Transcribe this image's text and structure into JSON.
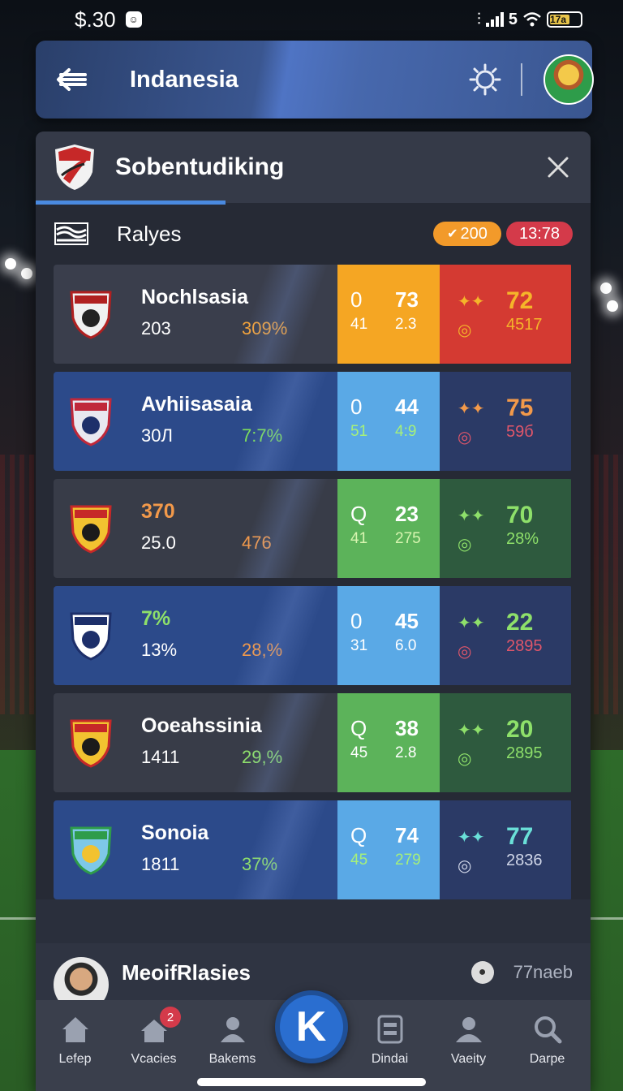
{
  "status": {
    "time": "$.30",
    "network": "5",
    "battery": "17a"
  },
  "app_bar": {
    "title": "Indanesia"
  },
  "panel": {
    "title": "Sobentudiking"
  },
  "section": {
    "title": "Ralyes",
    "pill_points": "200",
    "pill_time": "13:78"
  },
  "rows": [
    {
      "name": "Nochlsasia",
      "sub": "203",
      "pct": "309%",
      "pct_color": "#f2a23a",
      "m1": "0",
      "m2": "73",
      "m3": "41",
      "m4": "2.3",
      "r_top": "72",
      "r_bottom": "4517",
      "r_top_color": "#f5b52a",
      "r_bottom_color": "#f5b52a",
      "left_bg": "#3a3e4c",
      "mid_bg": "#f5a623",
      "right_bg": "#d43a32",
      "m_small_color": "#ffffff"
    },
    {
      "name": "Avhiisasaia",
      "sub": "30Л",
      "pct": "7:7%",
      "pct_color": "#7ee05a",
      "m1": "0",
      "m2": "44",
      "m3": "51",
      "m4": "4:9",
      "r_top": "75",
      "r_bottom": "59б",
      "r_top_color": "#f2994a",
      "r_bottom_color": "#e0566a",
      "left_bg": "#2c4a8a",
      "mid_bg": "#5aa9e6",
      "right_bg": "#2b3a66",
      "m_small_color": "#a6f07a"
    },
    {
      "name": "370",
      "sub": "25.0",
      "pct": "476",
      "pct_color": "#f2994a",
      "m1": "Q",
      "m2": "23",
      "m3": "41",
      "m4": "275",
      "r_top": "70",
      "r_bottom": "28%",
      "r_top_color": "#8ee06a",
      "r_bottom_color": "#8ee06a",
      "left_bg": "#383c48",
      "mid_bg": "#5cb35a",
      "right_bg": "#2e5a3e",
      "m_small_color": "#d8f5b0",
      "name_color": "#f2994a"
    },
    {
      "name": "7%",
      "sub": "13%",
      "pct": "28,%",
      "pct_color": "#f2994a",
      "m1": "0",
      "m2": "45",
      "m3": "31",
      "m4": "6.0",
      "r_top": "22",
      "r_bottom": "2895",
      "r_top_color": "#8ee06a",
      "r_bottom_color": "#e0566a",
      "left_bg": "#2c4a8a",
      "mid_bg": "#5aa9e6",
      "right_bg": "#2b3a66",
      "m_small_color": "#ffffff",
      "name_color": "#8ee06a"
    },
    {
      "name": "Ooeahssinia",
      "sub": "1411",
      "pct": "29,%",
      "pct_color": "#8ee06a",
      "m1": "Q",
      "m2": "38",
      "m3": "45",
      "m4": "2.8",
      "r_top": "20",
      "r_bottom": "2895",
      "r_top_color": "#8ee06a",
      "r_bottom_color": "#8ee06a",
      "left_bg": "#383c48",
      "mid_bg": "#5cb35a",
      "right_bg": "#2e5a3e",
      "m_small_color": "#ffffff"
    },
    {
      "name": "Sonoia",
      "sub": "1811",
      "pct": "37%",
      "pct_color": "#8ee06a",
      "m1": "Q",
      "m2": "74",
      "m3": "45",
      "m4": "279",
      "r_top": "77",
      "r_bottom": "2836",
      "r_top_color": "#6ae0d8",
      "r_bottom_color": "#d0d6e8",
      "left_bg": "#2c4a8a",
      "mid_bg": "#5aa9e6",
      "right_bg": "#2b3a66",
      "m_small_color": "#a6f07a"
    }
  ],
  "person": {
    "name": "MeoifRlasies",
    "meta": "77naeb"
  },
  "nav": {
    "item1": "Lefep",
    "item2": "Vcacies",
    "item2_badge": "2",
    "item3": "Bakems",
    "center": "K",
    "item4": "Dindai",
    "item5": "Vaeity",
    "item6": "Darpe"
  },
  "colors": {
    "accent": "#4a8ae0",
    "panel": "#2a2f3c",
    "badge": "#d43a4a"
  }
}
